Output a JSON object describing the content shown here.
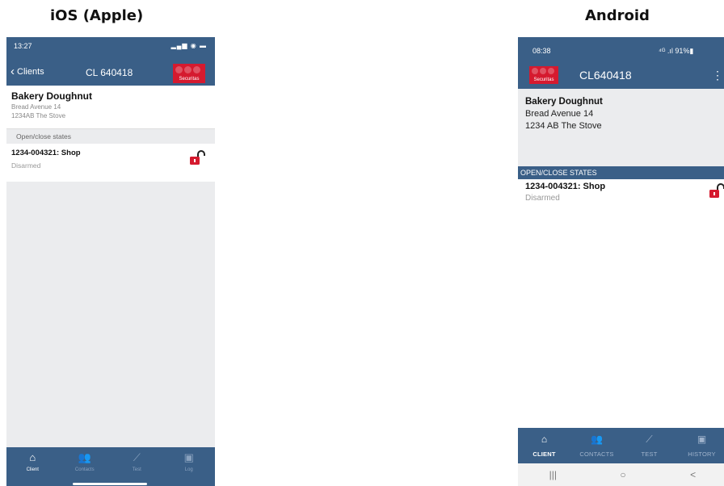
{
  "headings": {
    "ios": "iOS (Apple)",
    "android": "Android"
  },
  "ios": {
    "status_time": "13:27",
    "status_icons": "▂▄▆ ◉ ▬",
    "back_label": "Clients",
    "back_icon": "chevron-left-icon",
    "title": "CL 640418",
    "logo_text": "Securitas",
    "client": {
      "name": "Bakery Doughnut",
      "address1": "Bread Avenue 14",
      "address2": "1234AB  The Stove"
    },
    "section_label": "Open/close states",
    "state": {
      "title": "1234-004321: Shop",
      "status": "Disarmed",
      "icon": "open-lock-icon"
    },
    "tabs": [
      {
        "label": "Client",
        "icon": "home-icon"
      },
      {
        "label": "Contacts",
        "icon": "contacts-icon"
      },
      {
        "label": "Test",
        "icon": "test-wand-icon"
      },
      {
        "label": "Log",
        "icon": "clipboard-icon"
      }
    ],
    "active_tab": "Client",
    "colors": {
      "header": "#3a5f87",
      "brand": "#d51a2f",
      "lock": "#d51a2f"
    }
  },
  "android": {
    "status_time": "08:38",
    "status_icons": "⁴ᴳ .ıl 91%▮",
    "title": "CL640418",
    "logo_text": "Securitas",
    "menu_icon": "more-vert-icon",
    "client": {
      "name": "Bakery Doughnut",
      "address1": "Bread Avenue 14",
      "address2": "1234 AB The Stove"
    },
    "section_label": "OPEN/CLOSE STATES",
    "state": {
      "title": "1234-004321: Shop",
      "status": "Disarmed",
      "icon": "open-lock-icon"
    },
    "tabs": [
      {
        "label": "CLIENT",
        "icon": "home-icon"
      },
      {
        "label": "CONTACTS",
        "icon": "contacts-icon"
      },
      {
        "label": "TEST",
        "icon": "test-wand-icon"
      },
      {
        "label": "HISTORY",
        "icon": "clipboard-icon"
      }
    ],
    "active_tab": "CLIENT",
    "nav_buttons": [
      {
        "glyph": "|||",
        "icon": "recent-apps-icon"
      },
      {
        "glyph": "○",
        "icon": "home-circle-icon"
      },
      {
        "glyph": "<",
        "icon": "back-icon"
      }
    ]
  }
}
